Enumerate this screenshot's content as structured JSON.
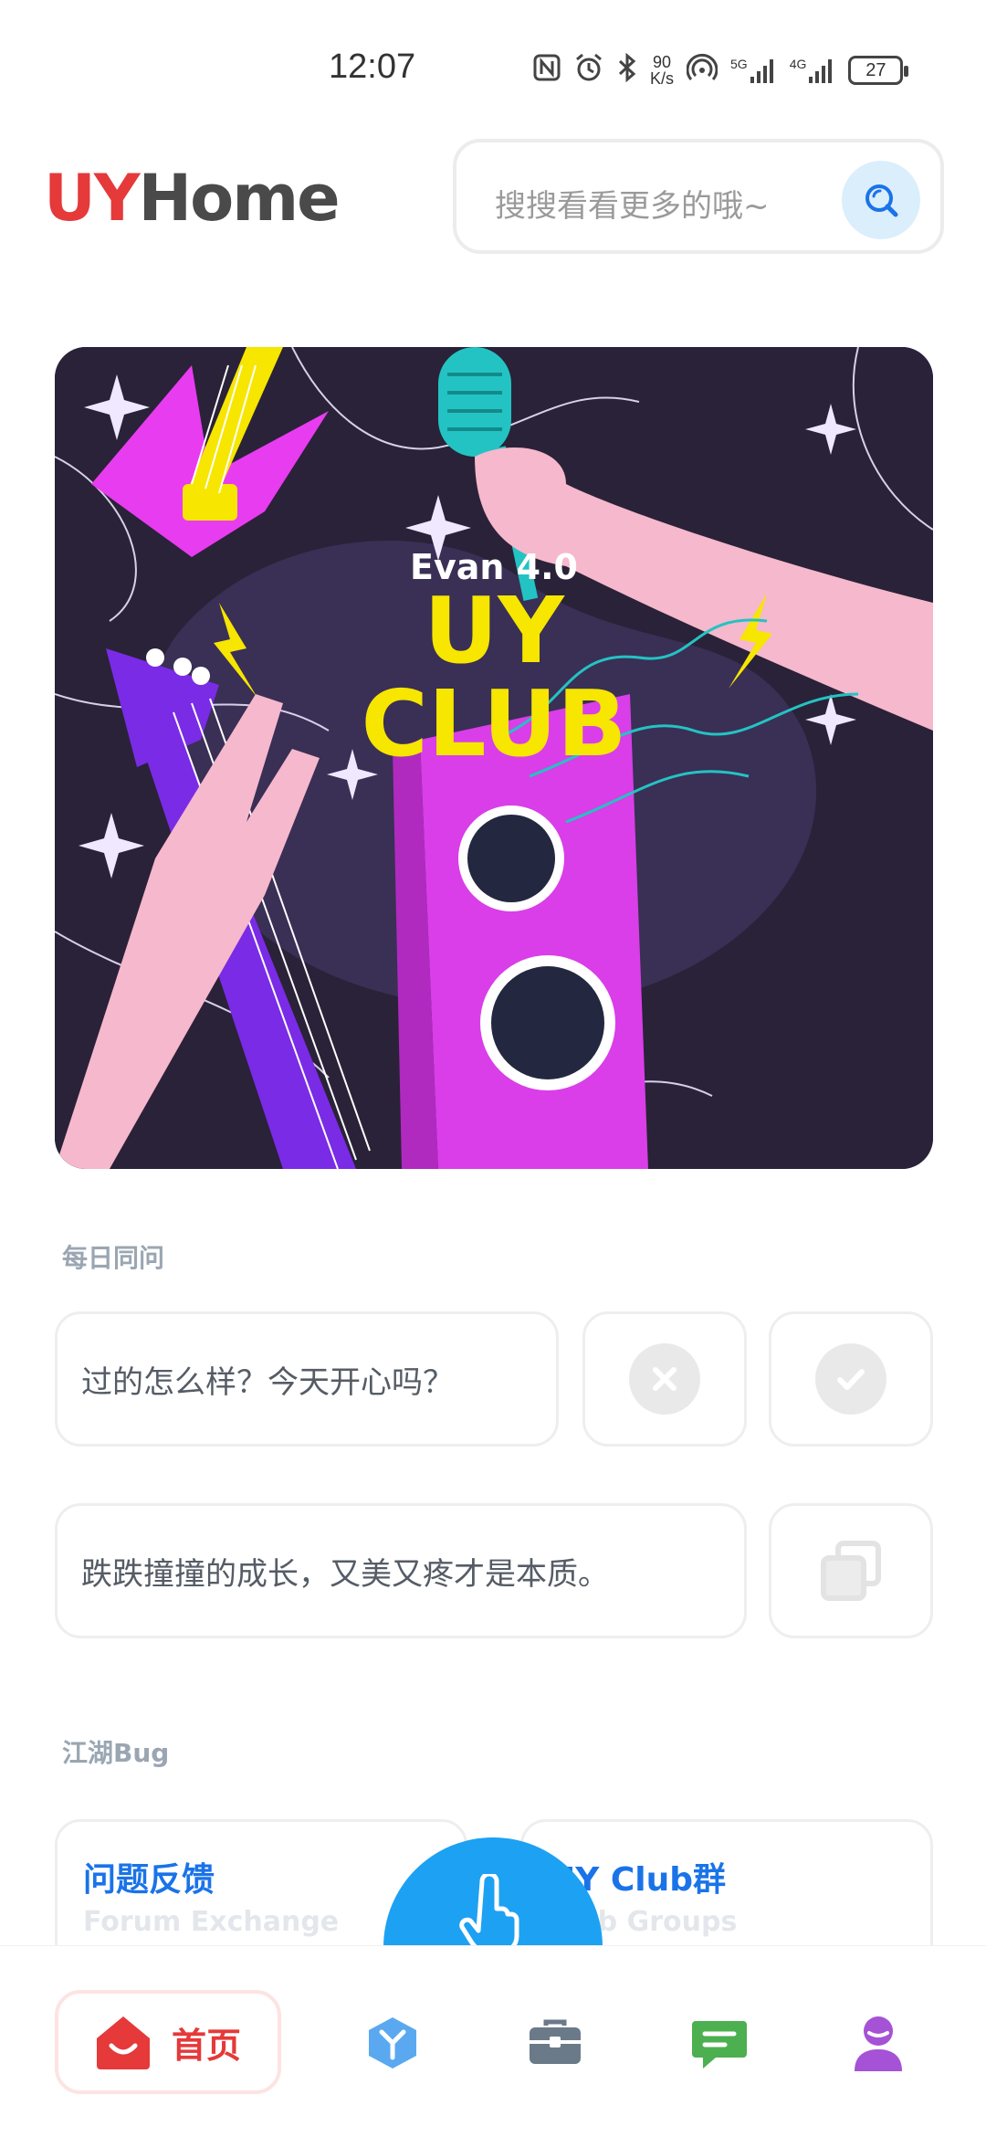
{
  "status_bar": {
    "time": "12:07",
    "speed_value": "90",
    "speed_unit": "K/s",
    "signal1_label": "5G",
    "signal2_label": "4G",
    "battery": "27"
  },
  "header": {
    "logo_part1": "UY",
    "logo_part2": "Home",
    "search_placeholder": "搜搜看看更多的哦~"
  },
  "banner": {
    "subtitle": "Evan 4.0",
    "title_line1": "UY",
    "title_line2": "CLUB"
  },
  "daily": {
    "section_title": "每日同问",
    "question": "过的怎么样？今天开心吗？",
    "quote": "跌跌撞撞的成长，又美又疼才是本质。"
  },
  "bugs": {
    "section_title": "江湖Bug",
    "cards": [
      {
        "title": "问题反馈",
        "subtitle": "Forum Exchange"
      },
      {
        "title": "UY Club群",
        "subtitle": "Club Groups"
      }
    ]
  },
  "bottom_nav": {
    "home_label": "首页"
  },
  "colors": {
    "brand_red": "#e5393a",
    "accent_blue": "#1da1f2",
    "banner_bg": "#2a2238",
    "banner_text": "#f6e600"
  }
}
